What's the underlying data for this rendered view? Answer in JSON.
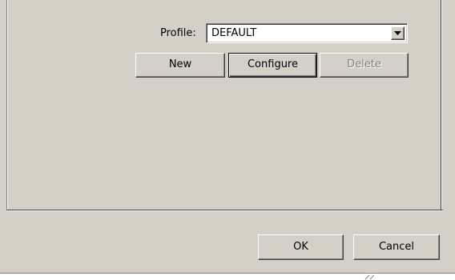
{
  "profile": {
    "label": "Profile:",
    "selected_value": "DEFAULT"
  },
  "profile_buttons": {
    "new_label": "New",
    "configure_label": "Configure",
    "delete_label": "Delete"
  },
  "dialog_buttons": {
    "ok_label": "OK",
    "cancel_label": "Cancel"
  },
  "icons": {
    "combo_arrow": "chevron-down-icon"
  },
  "colors": {
    "face": "#d4d0c8",
    "disabled_text": "#808080"
  }
}
